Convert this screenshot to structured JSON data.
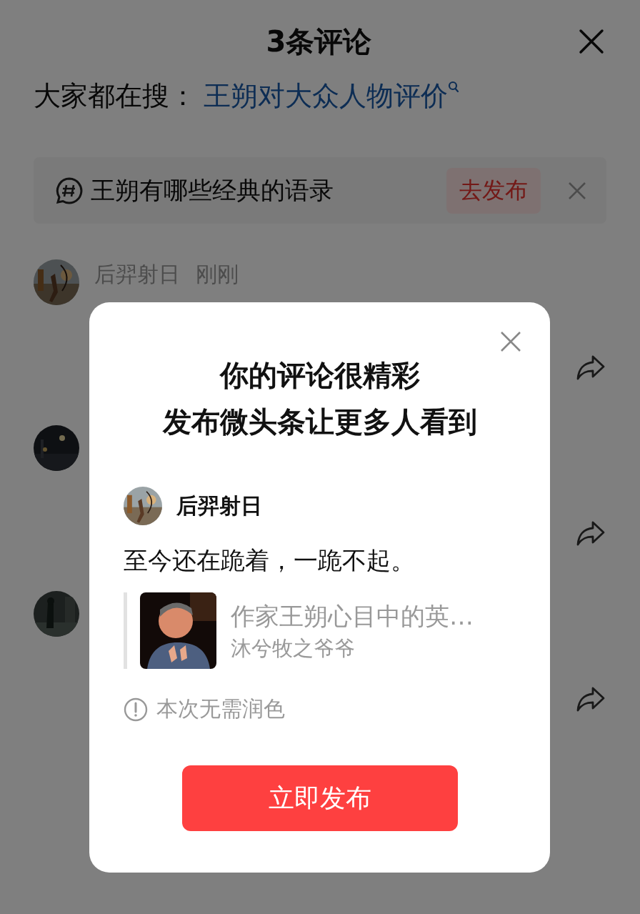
{
  "header": {
    "title": "3条评论"
  },
  "search_hint": {
    "label": "大家都在搜：",
    "query": "王朔对大众人物评价"
  },
  "topic": {
    "text": "王朔有哪些经典的语录",
    "action": "去发布"
  },
  "comments": [
    {
      "avatar": {
        "kind": "picture"
      },
      "author": "后羿射日",
      "time": "刚刚"
    },
    {
      "avatar": {
        "kind": "picture"
      }
    },
    {
      "avatar": {
        "kind": "picture"
      }
    }
  ],
  "dialog": {
    "title_lines": [
      "你的评论很精彩",
      "发布微头条让更多人看到"
    ],
    "author": "后羿射日",
    "avatar": {
      "kind": "picture"
    },
    "text": "至今还在跪着，一跪不起。",
    "quote": {
      "thumbnail": {
        "kind": "picture"
      },
      "title": "作家王朔心目中的英…",
      "source": "沐兮牧之爷爷"
    },
    "hint": "本次无需润色",
    "button": "立即发布"
  }
}
